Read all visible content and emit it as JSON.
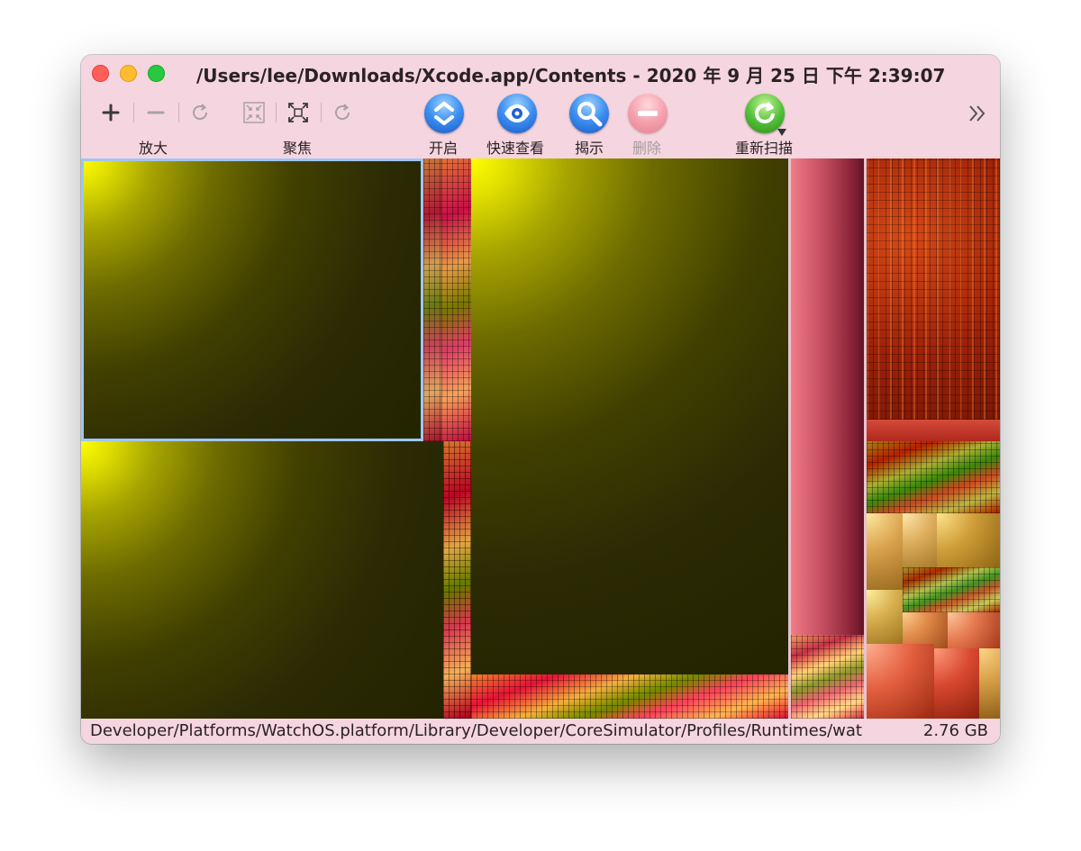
{
  "window": {
    "title": "/Users/lee/Downloads/Xcode.app/Contents - 2020 年 9 月 25 日 下午 2:39:07"
  },
  "toolbar": {
    "zoom_label": "放大",
    "focus_label": "聚焦",
    "open_label": "开启",
    "quicklook_label": "快速查看",
    "reveal_label": "揭示",
    "delete_label": "删除",
    "rescan_label": "重新扫描",
    "icons": {
      "zoom_in": "plus-icon",
      "zoom_out": "minus-icon",
      "zoom_reset": "redo-icon",
      "focus_in": "collapse-arrows-icon",
      "focus_out": "expand-arrows-icon",
      "focus_reset": "redo-icon",
      "open": "open-arrows-icon",
      "quicklook": "eye-icon",
      "reveal": "magnifier-icon",
      "delete": "minus-circle-icon",
      "rescan": "refresh-icon",
      "overflow": "chevron-double-right-icon"
    }
  },
  "colors": {
    "window_bg": "#f5d5df",
    "large_file_tile": "#ffff00",
    "selection_outline": "#9ec6f2",
    "pink_tile": "#e56d7c",
    "orange_tile": "#a8220a"
  },
  "status": {
    "path": "Developer/Platforms/WatchOS.platform/Library/Developer/CoreSimulator/Profiles/Runtimes/wat",
    "size": "2.76 GB"
  }
}
